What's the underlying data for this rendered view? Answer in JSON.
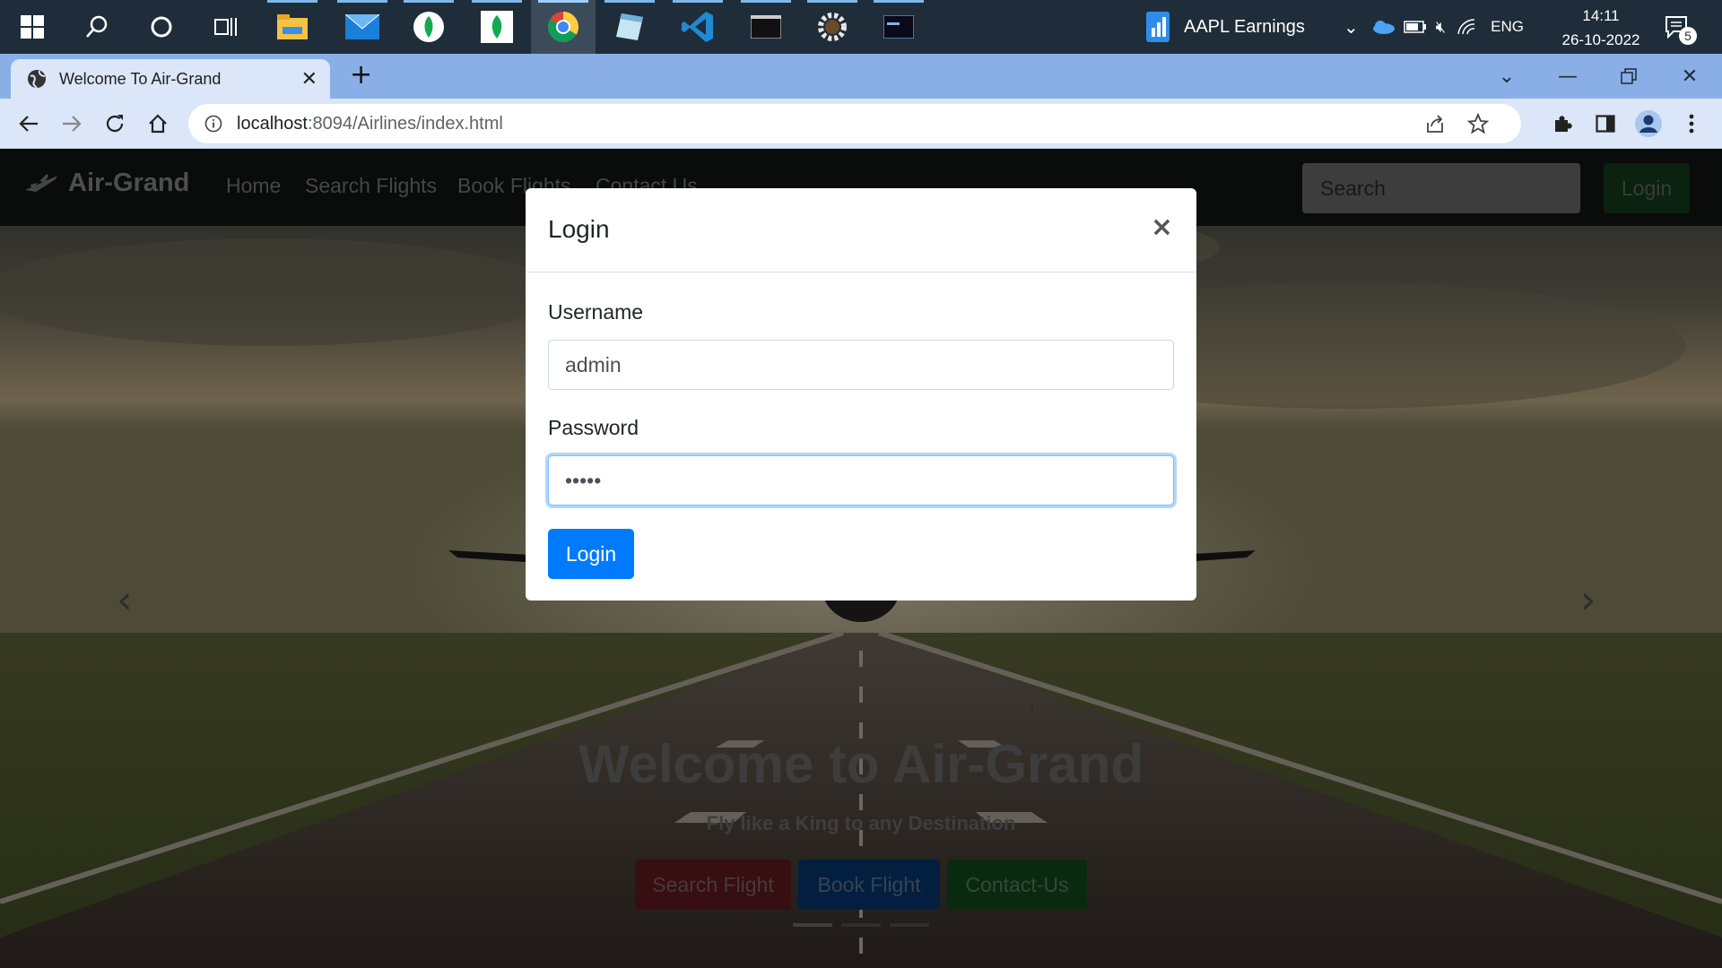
{
  "taskbar": {
    "widget": {
      "label": "AAPL Earnings",
      "icon": "chart-widget-icon"
    },
    "tray": {
      "language": "ENG"
    },
    "clock": {
      "time": "14:11",
      "date": "26-10-2022"
    },
    "notifications": {
      "count": "5"
    },
    "pinned": [
      "start-icon",
      "search-icon",
      "cortana-icon",
      "task-view-icon",
      "file-explorer-icon",
      "mail-icon",
      "mongodb-compass-icon",
      "mongodb-icon",
      "chrome-icon",
      "notepad-icon",
      "vscode-icon",
      "terminal-icon",
      "settings-gear-icon",
      "mysql-icon"
    ]
  },
  "browser": {
    "tab": {
      "title": "Welcome To Air-Grand"
    },
    "url": {
      "host": "localhost",
      "rest": ":8094/Airlines/index.html"
    }
  },
  "site": {
    "brand": "Air-Grand",
    "nav": [
      "Home",
      "Search Flights",
      "Book Flights",
      "Contact Us"
    ],
    "search_placeholder": "Search",
    "login_label": "Login",
    "hero": {
      "title": "Welcome to Air-Grand",
      "subtitle": "Fly like a King to any Destination",
      "buttons": [
        "Search Flight",
        "Book Flight",
        "Contact-Us"
      ]
    }
  },
  "modal": {
    "title": "Login",
    "username_label": "Username",
    "username_value": "admin",
    "password_label": "Password",
    "password_value": "•••••",
    "submit_label": "Login"
  },
  "colors": {
    "primary": "#007bff",
    "success": "#28a745",
    "danger": "#dc3545"
  }
}
